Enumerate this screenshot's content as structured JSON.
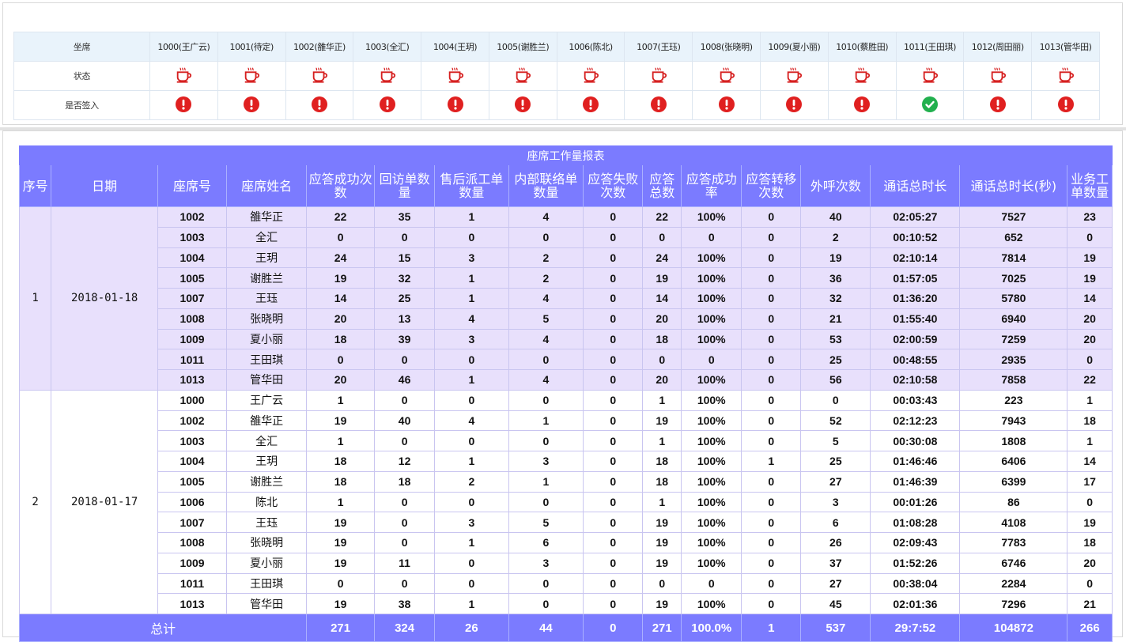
{
  "status": {
    "row_labels": {
      "seat": "坐席",
      "state": "状态",
      "signed_in": "是否签入"
    },
    "seats": [
      {
        "label": "1000(王广云)",
        "state_icon": "coffee-cup-icon",
        "signed_in": false
      },
      {
        "label": "1001(待定)",
        "state_icon": "coffee-cup-icon",
        "signed_in": false
      },
      {
        "label": "1002(雒华正)",
        "state_icon": "coffee-cup-icon",
        "signed_in": false
      },
      {
        "label": "1003(全汇)",
        "state_icon": "coffee-cup-icon",
        "signed_in": false
      },
      {
        "label": "1004(王玥)",
        "state_icon": "coffee-cup-icon",
        "signed_in": false
      },
      {
        "label": "1005(谢胜兰)",
        "state_icon": "coffee-cup-icon",
        "signed_in": false
      },
      {
        "label": "1006(陈北)",
        "state_icon": "coffee-cup-icon",
        "signed_in": false
      },
      {
        "label": "1007(王珏)",
        "state_icon": "coffee-cup-icon",
        "signed_in": false
      },
      {
        "label": "1008(张晓明)",
        "state_icon": "coffee-cup-icon",
        "signed_in": false
      },
      {
        "label": "1009(夏小丽)",
        "state_icon": "coffee-cup-icon",
        "signed_in": false
      },
      {
        "label": "1010(蔡胜田)",
        "state_icon": "coffee-cup-icon",
        "signed_in": false
      },
      {
        "label": "1011(王田琪)",
        "state_icon": "coffee-cup-icon",
        "signed_in": true
      },
      {
        "label": "1012(周田丽)",
        "state_icon": "coffee-cup-icon",
        "signed_in": false
      },
      {
        "label": "1013(管华田)",
        "state_icon": "coffee-cup-icon",
        "signed_in": false
      }
    ],
    "colors": {
      "signed_out": "#e02020",
      "signed_in": "#22b04e",
      "cup": "#d62020"
    }
  },
  "report": {
    "title": "座席工作量报表",
    "headers": [
      "序号",
      "日期",
      "座席号",
      "座席姓名",
      "应答成功次数",
      "回访单数量",
      "售后派工单数量",
      "内部联络单数量",
      "应答失败次数",
      "应答总数",
      "应答成功率",
      "应答转移次数",
      "外呼次数",
      "通话总时长",
      "通话总时长(秒)",
      "业务工单数量"
    ],
    "groups": [
      {
        "seq": "1",
        "date": "2018-01-18",
        "rows": [
          [
            "1002",
            "雒华正",
            "22",
            "35",
            "1",
            "4",
            "0",
            "22",
            "100%",
            "0",
            "40",
            "02:05:27",
            "7527",
            "23"
          ],
          [
            "1003",
            "全汇",
            "0",
            "0",
            "0",
            "0",
            "0",
            "0",
            "0",
            "0",
            "2",
            "00:10:52",
            "652",
            "0"
          ],
          [
            "1004",
            "王玥",
            "24",
            "15",
            "3",
            "2",
            "0",
            "24",
            "100%",
            "0",
            "19",
            "02:10:14",
            "7814",
            "19"
          ],
          [
            "1005",
            "谢胜兰",
            "19",
            "32",
            "1",
            "2",
            "0",
            "19",
            "100%",
            "0",
            "36",
            "01:57:05",
            "7025",
            "19"
          ],
          [
            "1007",
            "王珏",
            "14",
            "25",
            "1",
            "4",
            "0",
            "14",
            "100%",
            "0",
            "32",
            "01:36:20",
            "5780",
            "14"
          ],
          [
            "1008",
            "张晓明",
            "20",
            "13",
            "4",
            "5",
            "0",
            "20",
            "100%",
            "0",
            "21",
            "01:55:40",
            "6940",
            "20"
          ],
          [
            "1009",
            "夏小丽",
            "18",
            "39",
            "3",
            "4",
            "0",
            "18",
            "100%",
            "0",
            "53",
            "02:00:59",
            "7259",
            "20"
          ],
          [
            "1011",
            "王田琪",
            "0",
            "0",
            "0",
            "0",
            "0",
            "0",
            "0",
            "0",
            "25",
            "00:48:55",
            "2935",
            "0"
          ],
          [
            "1013",
            "管华田",
            "20",
            "46",
            "1",
            "4",
            "0",
            "20",
            "100%",
            "0",
            "56",
            "02:10:58",
            "7858",
            "22"
          ]
        ]
      },
      {
        "seq": "2",
        "date": "2018-01-17",
        "rows": [
          [
            "1000",
            "王广云",
            "1",
            "0",
            "0",
            "0",
            "0",
            "1",
            "100%",
            "0",
            "0",
            "00:03:43",
            "223",
            "1"
          ],
          [
            "1002",
            "雒华正",
            "19",
            "40",
            "4",
            "1",
            "0",
            "19",
            "100%",
            "0",
            "52",
            "02:12:23",
            "7943",
            "18"
          ],
          [
            "1003",
            "全汇",
            "1",
            "0",
            "0",
            "0",
            "0",
            "1",
            "100%",
            "0",
            "5",
            "00:30:08",
            "1808",
            "1"
          ],
          [
            "1004",
            "王玥",
            "18",
            "12",
            "1",
            "3",
            "0",
            "18",
            "100%",
            "1",
            "25",
            "01:46:46",
            "6406",
            "14"
          ],
          [
            "1005",
            "谢胜兰",
            "18",
            "18",
            "2",
            "1",
            "0",
            "18",
            "100%",
            "0",
            "27",
            "01:46:39",
            "6399",
            "17"
          ],
          [
            "1006",
            "陈北",
            "1",
            "0",
            "0",
            "0",
            "0",
            "1",
            "100%",
            "0",
            "3",
            "00:01:26",
            "86",
            "0"
          ],
          [
            "1007",
            "王珏",
            "19",
            "0",
            "3",
            "5",
            "0",
            "19",
            "100%",
            "0",
            "6",
            "01:08:28",
            "4108",
            "19"
          ],
          [
            "1008",
            "张晓明",
            "19",
            "0",
            "1",
            "6",
            "0",
            "19",
            "100%",
            "0",
            "26",
            "02:09:43",
            "7783",
            "18"
          ],
          [
            "1009",
            "夏小丽",
            "19",
            "11",
            "0",
            "3",
            "0",
            "19",
            "100%",
            "0",
            "37",
            "01:52:26",
            "6746",
            "20"
          ],
          [
            "1011",
            "王田琪",
            "0",
            "0",
            "0",
            "0",
            "0",
            "0",
            "0",
            "0",
            "27",
            "00:38:04",
            "2284",
            "0"
          ],
          [
            "1013",
            "管华田",
            "19",
            "38",
            "1",
            "0",
            "0",
            "19",
            "100%",
            "0",
            "45",
            "02:01:36",
            "7296",
            "21"
          ]
        ]
      }
    ],
    "total_label": "总计",
    "totals": [
      "271",
      "324",
      "26",
      "44",
      "0",
      "271",
      "100.0%",
      "1",
      "537",
      "29:7:52",
      "104872",
      "266"
    ],
    "colors": {
      "header": "#7b7bff",
      "group1_row": "#e8e0fc",
      "group2_row": "#ffffff"
    }
  }
}
